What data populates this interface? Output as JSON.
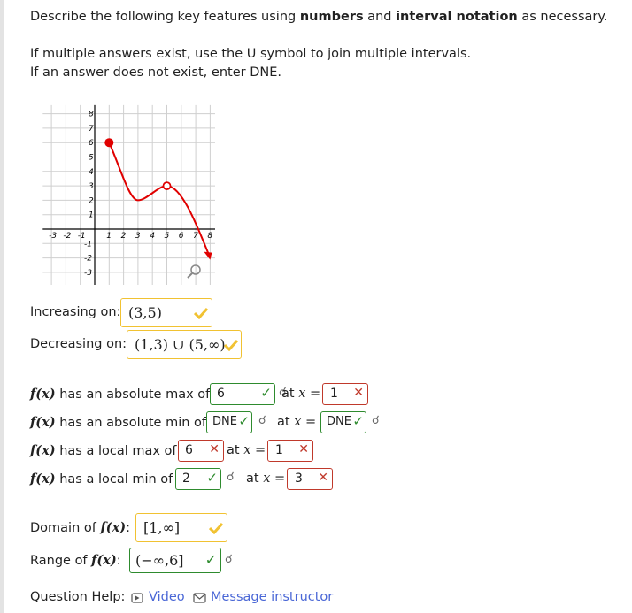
{
  "question": {
    "line1_pre": "Describe the following key features using ",
    "line1_b1": "numbers",
    "line1_mid": " and ",
    "line1_b2": "interval notation",
    "line1_post": " as necessary.",
    "line2": "If multiple answers exist, use the U symbol to join multiple intervals.",
    "line3": "If an answer does not exist, enter DNE."
  },
  "graph": {
    "x_ticks": [
      "-3",
      "-2",
      "-1",
      "1",
      "2",
      "3",
      "4",
      "5",
      "6",
      "7",
      "8"
    ],
    "y_ticks": [
      "8",
      "7",
      "6",
      "5",
      "4",
      "3",
      "2",
      "1",
      "-1",
      "-2",
      "-3"
    ],
    "closed_point": [
      1,
      6
    ],
    "open_point": [
      5,
      3
    ],
    "local_min_point": [
      3,
      2
    ],
    "end_arrow_point": [
      8,
      -2
    ],
    "curve_color": "#e00000"
  },
  "increasing": {
    "label": "Increasing on:",
    "value": "(3,5)",
    "status": "accepted"
  },
  "decreasing": {
    "label": "Decreasing on:",
    "value": "(1,3) ∪ (5,∞)",
    "status": "accepted"
  },
  "abs_max": {
    "fx": "f(x)",
    "label": "has an absolute max of",
    "value": "6",
    "value_status": "correct",
    "at": "at",
    "x": "x",
    "eq": "=",
    "x_value": "1",
    "x_status": "incorrect"
  },
  "abs_min": {
    "fx": "f(x)",
    "label": "has an absolute min of",
    "value": "DNE",
    "value_status": "correct",
    "at": "at",
    "x": "x",
    "eq": "=",
    "x_value": "DNE",
    "x_status": "correct"
  },
  "local_max": {
    "fx": "f(x)",
    "label": "has a local max of",
    "value": "6",
    "value_status": "incorrect",
    "at": "at",
    "x": "x",
    "eq": "=",
    "x_value": "1",
    "x_status": "incorrect"
  },
  "local_min": {
    "fx": "f(x)",
    "label": "has a local min of",
    "value": "2",
    "value_status": "correct",
    "at": "at",
    "x": "x",
    "eq": "=",
    "x_value": "3",
    "x_status": "incorrect"
  },
  "domain": {
    "label": "Domain of",
    "fx": "f(x)",
    "colon": ":",
    "value": "[1,∞]",
    "status": "accepted"
  },
  "range": {
    "label": "Range of",
    "fx": "f(x)",
    "colon": ":",
    "value": "(−∞,6]",
    "status": "correct"
  },
  "help": {
    "label": "Question Help:",
    "video": "Video",
    "message": "Message instructor"
  },
  "colors": {
    "correct": "#2e8b2e",
    "incorrect": "#c0392b",
    "accepted": "#f1c232",
    "link": "#4a67d6"
  }
}
